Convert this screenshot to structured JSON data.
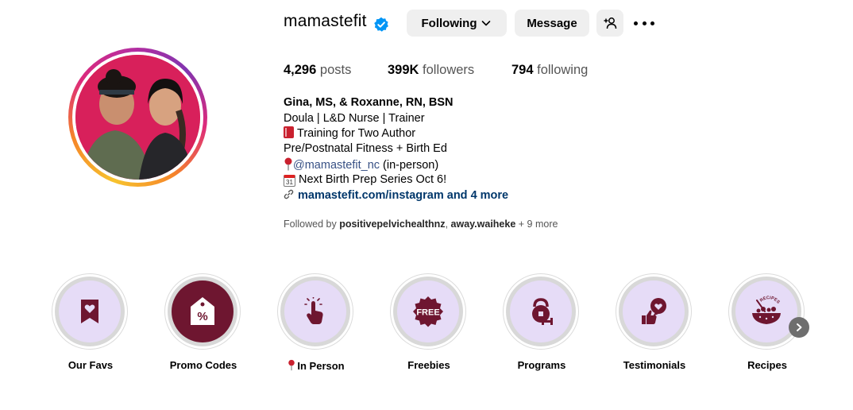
{
  "profile": {
    "username": "mamastefit",
    "verified": true,
    "buttons": {
      "following": "Following",
      "message": "Message"
    },
    "stats": [
      {
        "value": "4,296",
        "label": "posts"
      },
      {
        "value": "399K",
        "label": "followers"
      },
      {
        "value": "794",
        "label": "following"
      }
    ]
  },
  "bio": {
    "name": "Gina, MS, & Roxanne, RN, BSN",
    "line1": "Doula | L&D Nurse | Trainer",
    "line2": "Training for Two Author",
    "line3": "Pre/Postnatal Fitness + Birth Ed",
    "line4_link": "@mamastefit_nc",
    "line4_rest": " (in-person)",
    "line5": "Next Birth Prep Series Oct 6!",
    "calendar_day": "31",
    "website": "mamastefit.com/instagram and 4 more"
  },
  "followed_by": {
    "prefix": "Followed by ",
    "user1": "positivepelvichealthnz",
    "sep": ", ",
    "user2": "away.waiheke",
    "suffix": " + 9 more"
  },
  "highlights": [
    {
      "label": "Our Favs",
      "icon": "bookmark-heart-icon"
    },
    {
      "label": "Promo Codes",
      "icon": "percent-tag-icon"
    },
    {
      "label": "In Person",
      "icon": "pointing-hand-icon"
    },
    {
      "label": "Freebies",
      "icon": "free-badge-icon"
    },
    {
      "label": "Programs",
      "icon": "kettlebell-icon"
    },
    {
      "label": "Testimonials",
      "icon": "thumbs-up-heart-icon"
    },
    {
      "label": "Recipes",
      "icon": "food-bowl-icon"
    }
  ],
  "highlight_icon_text": {
    "free": "FREE",
    "percent": "%",
    "recipes": "RECIPES"
  },
  "colors": {
    "highlight_bg": "#e6dcf7",
    "icon_maroon": "#6e1630",
    "verified_blue": "#0095f6",
    "photo_bg": "#d8205b"
  }
}
